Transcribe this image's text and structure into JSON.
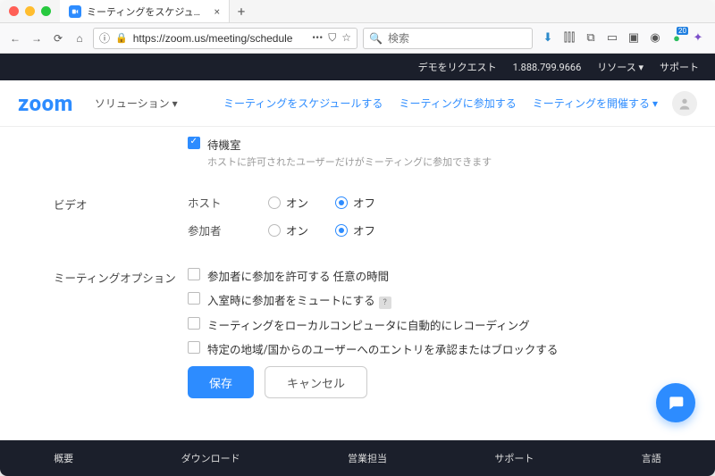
{
  "browser": {
    "tab_title": "ミーティングをスケジュールする",
    "url": "https://zoom.us/meeting/schedule",
    "search_placeholder": "検索",
    "ext_badge": "20"
  },
  "topbar": {
    "demo": "デモをリクエスト",
    "phone": "1.888.799.9666",
    "resources": "リソース ▾",
    "support": "サポート"
  },
  "header": {
    "logo": "zoom",
    "solutions": "ソリューション ▾",
    "schedule": "ミーティングをスケジュールする",
    "join": "ミーティングに参加する",
    "host": "ミーティングを開催する ▾"
  },
  "form": {
    "waiting_room_label": "待機室",
    "waiting_room_sub": "ホストに許可されたユーザーだけがミーティングに参加できます",
    "section_video": "ビデオ",
    "host": "ホスト",
    "participant": "参加者",
    "on": "オン",
    "off": "オフ",
    "section_options": "ミーティングオプション",
    "opt_join_anytime": "参加者に参加を許可する 任意の時間",
    "opt_mute": "入室時に参加者をミュートにする",
    "opt_record": "ミーティングをローカルコンピュータに自動的にレコーディング",
    "opt_region": "特定の地域/国からのユーザーへのエントリを承認またはブロックする",
    "save": "保存",
    "cancel": "キャンセル"
  },
  "footer": {
    "c1": "概要",
    "c2": "ダウンロード",
    "c3": "営業担当",
    "c4": "サポート",
    "c5": "言語"
  }
}
